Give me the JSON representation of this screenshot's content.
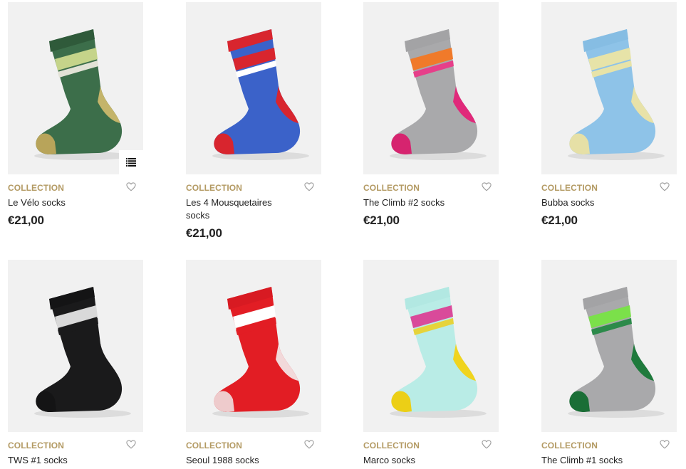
{
  "products": [
    {
      "collection": "COLLECTION",
      "name": "Le Vélo socks",
      "price": "€21,00",
      "colors": {
        "main": "#3c6e4a",
        "cuff": "#2f5a3a",
        "stripe": "#c5d48a",
        "stripe2": "#e2e2d6",
        "heel": "#c4b46a",
        "toe": "#b8a45a"
      }
    },
    {
      "collection": "COLLECTION",
      "name": "Les 4 Mousquetaires socks",
      "price": "€21,00",
      "colors": {
        "main": "#3b62c9",
        "cuff": "#d8252e",
        "stripe": "#d8252e",
        "stripe2": "#ffffff",
        "heel": "#d8252e",
        "toe": "#d8252e"
      }
    },
    {
      "collection": "COLLECTION",
      "name": "The Climb #2 socks",
      "price": "€21,00",
      "colors": {
        "main": "#a9a9ab",
        "cuff": "#a3a3a5",
        "stripe": "#f07a2a",
        "stripe2": "#e63f8a",
        "heel": "#e0297a",
        "toe": "#d6246f"
      }
    },
    {
      "collection": "COLLECTION",
      "name": "Bubba socks",
      "price": "€21,00",
      "colors": {
        "main": "#8ec3e8",
        "cuff": "#86bde3",
        "stripe": "#e7e3a8",
        "stripe2": "#e7e3a8",
        "heel": "#e8e2a8",
        "toe": "#e6e0a6"
      }
    },
    {
      "collection": "COLLECTION",
      "name": "TWS #1 socks",
      "price": "",
      "colors": {
        "main": "#1a1a1b",
        "cuff": "#141415",
        "stripe": "#d9d9d9",
        "stripe2": "#1a1a1b",
        "heel": "#1a1a1b",
        "toe": "#141415"
      }
    },
    {
      "collection": "COLLECTION",
      "name": "Seoul 1988 socks",
      "price": "",
      "colors": {
        "main": "#e21d24",
        "cuff": "#d81a22",
        "stripe": "#ffffff",
        "stripe2": "#e21d24",
        "heel": "#f2d9da",
        "toe": "#eecbcc"
      }
    },
    {
      "collection": "COLLECTION",
      "name": "Marco socks",
      "price": "",
      "colors": {
        "main": "#b9ece6",
        "cuff": "#b2e8e2",
        "stripe": "#d94a9a",
        "stripe2": "#e6d33a",
        "heel": "#f0d41e",
        "toe": "#eccf16"
      }
    },
    {
      "collection": "COLLECTION",
      "name": "The Climb #1 socks",
      "price": "",
      "colors": {
        "main": "#a9a9ab",
        "cuff": "#a3a3a5",
        "stripe": "#7be04a",
        "stripe2": "#2c8a4a",
        "heel": "#1f7a3c",
        "toe": "#1a6e36"
      }
    }
  ],
  "icons": {
    "view_toggle": "list-view-icon",
    "wishlist": "heart-outline-icon"
  },
  "accent_color": "#b39a63"
}
